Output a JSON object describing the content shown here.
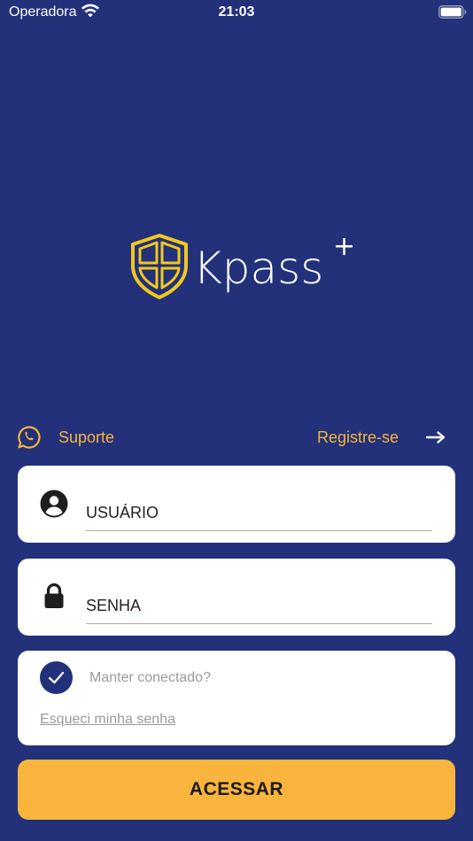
{
  "status_bar": {
    "carrier": "Operadora",
    "time": "21:03",
    "wifi_icon": "wifi-icon",
    "battery_icon": "battery-icon"
  },
  "logo": {
    "text": "Kpass",
    "superscript": "+",
    "icon": "shield-icon"
  },
  "links": {
    "support_label": "Suporte",
    "support_icon": "whatsapp-icon",
    "register_label": "Registre-se",
    "register_icon": "arrow-right-icon"
  },
  "form": {
    "username": {
      "placeholder": "USUÁRIO",
      "value": "",
      "icon": "user-icon"
    },
    "password": {
      "placeholder": "SENHA",
      "value": "",
      "icon": "lock-icon"
    },
    "keep_connected": {
      "label": "Manter conectado?",
      "checked": true
    },
    "forgot_password": "Esqueci minha senha",
    "submit_label": "ACESSAR"
  },
  "colors": {
    "background": "#22317a",
    "accent": "#f9b43e",
    "link": "#f7b43c",
    "card": "#ffffff",
    "muted_text": "#9a9a9a"
  }
}
